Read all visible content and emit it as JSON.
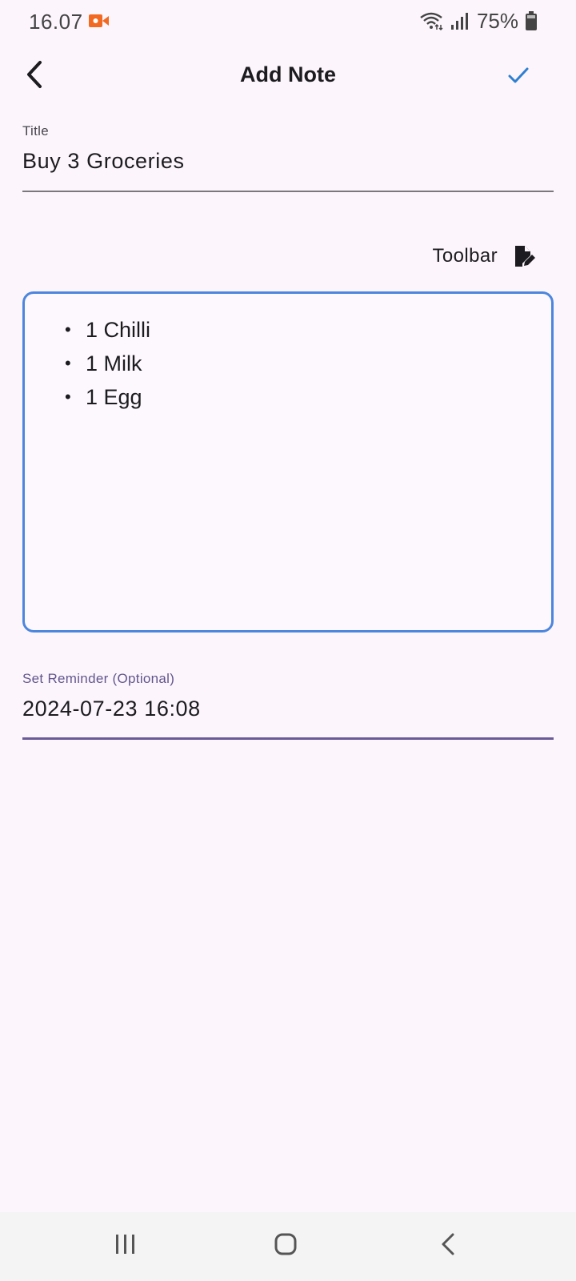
{
  "status_bar": {
    "time": "16.07",
    "battery_percent": "75%",
    "icons": [
      "screen-record-icon",
      "wifi-icon",
      "signal-icon",
      "battery-icon"
    ],
    "record_color": "#f26a21"
  },
  "app_bar": {
    "title": "Add Note",
    "back_icon": "chevron-left-icon",
    "save_icon": "check-icon",
    "save_color": "#2f7fd1"
  },
  "title_field": {
    "label": "Title",
    "value": "Buy 3 Groceries"
  },
  "toolbar_toggle": {
    "label": "Toolbar",
    "icon": "note-edit-icon"
  },
  "editor": {
    "border_color": "#4c86dd",
    "items": [
      "1 Chilli",
      "1 Milk",
      "1 Egg"
    ]
  },
  "reminder_field": {
    "label": "Set Reminder (Optional)",
    "value": "2024-07-23 16:08",
    "accent_color": "#6a5a98"
  },
  "nav_bar": {
    "icons": [
      "recents-icon",
      "home-icon",
      "back-icon"
    ]
  }
}
